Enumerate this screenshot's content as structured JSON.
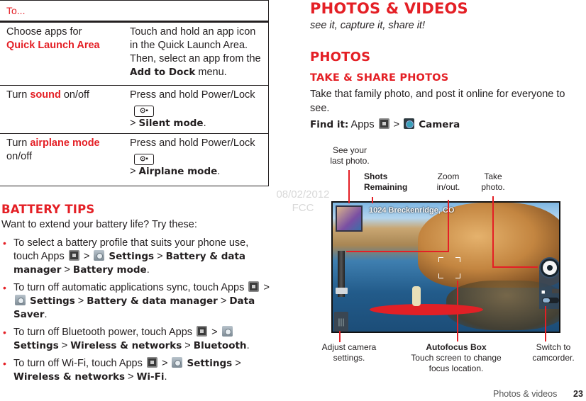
{
  "watermark": {
    "date": "08/02/2012",
    "label": "FCC"
  },
  "table": {
    "header": "To...",
    "rows": [
      {
        "action_prefix": "Choose apps for",
        "action_highlight": "Quick Launch Area",
        "action_suffix": "",
        "how_text": "Touch and hold an app icon in the Quick Launch Area. Then, select an app from the ",
        "how_bold": "Add to Dock",
        "how_end": " menu."
      },
      {
        "action_prefix": "Turn ",
        "action_highlight": "sound",
        "action_suffix": " on/off",
        "how_text": "Press and hold Power/Lock",
        "key_icon": "power-lock-key",
        "key_glyph": "⊙🔒",
        "how_sep": "> ",
        "how_bold": "Silent mode",
        "how_end": "."
      },
      {
        "action_prefix": "Turn ",
        "action_highlight": "airplane mode",
        "action_suffix": " on/off",
        "how_text": "Press and hold Power/Lock",
        "key_icon": "power-lock-key",
        "key_glyph": "⊙🔒",
        "how_sep": "> ",
        "how_bold": "Airplane mode",
        "how_end": "."
      }
    ]
  },
  "battery": {
    "title": "BATTERY TIPS",
    "intro": "Want to extend your battery life? Try these:",
    "tips": [
      {
        "text1": "To select a battery profile that suits your phone use, touch Apps",
        "p1": "Settings",
        "p2": "Battery & data manager",
        "p3": "Battery mode"
      },
      {
        "text1": "To turn off automatic applications sync, touch Apps",
        "p1": "Settings",
        "p2": "Battery & data manager",
        "p3": "Data Saver"
      },
      {
        "text1": "To turn off Bluetooth power, touch Apps",
        "p1": "Settings",
        "p2": "Wireless & networks",
        "p3": "Bluetooth"
      },
      {
        "text1": "To turn off Wi-Fi, touch Apps",
        "p1": "Settings",
        "p2": "Wireless & networks",
        "p3": "Wi-Fi"
      }
    ],
    "separator": ">",
    "end": "."
  },
  "photos": {
    "title": "PHOTOS & VIDEOS",
    "subtitle": "see it, capture it, share it!",
    "section": "PHOTOS",
    "subsection": "TAKE & SHARE PHOTOS",
    "body": "Take that family photo, and post it online for everyone to see.",
    "find_it_label": "Find it:",
    "find_it_apps": "Apps",
    "find_it_sep": ">",
    "find_it_target": "Camera"
  },
  "camera_screen": {
    "location_text": "1024  Breckenridge, CO",
    "settings_glyph": "|||",
    "photo_mode_glyph": "📷"
  },
  "callouts": {
    "last_photo": "See your last photo.",
    "shots_remaining": "Shots Remaining",
    "zoom": "Zoom in/out.",
    "take_photo": "Take photo.",
    "adjust_settings": "Adjust camera settings.",
    "autofocus_title": "Autofocus Box",
    "autofocus_desc": "Touch screen to change focus location.",
    "switch_camcorder": "Switch to camcorder."
  },
  "footer": {
    "section": "Photos & videos",
    "page": "23"
  },
  "colors": {
    "accent": "#e41f25",
    "text": "#231f20"
  }
}
